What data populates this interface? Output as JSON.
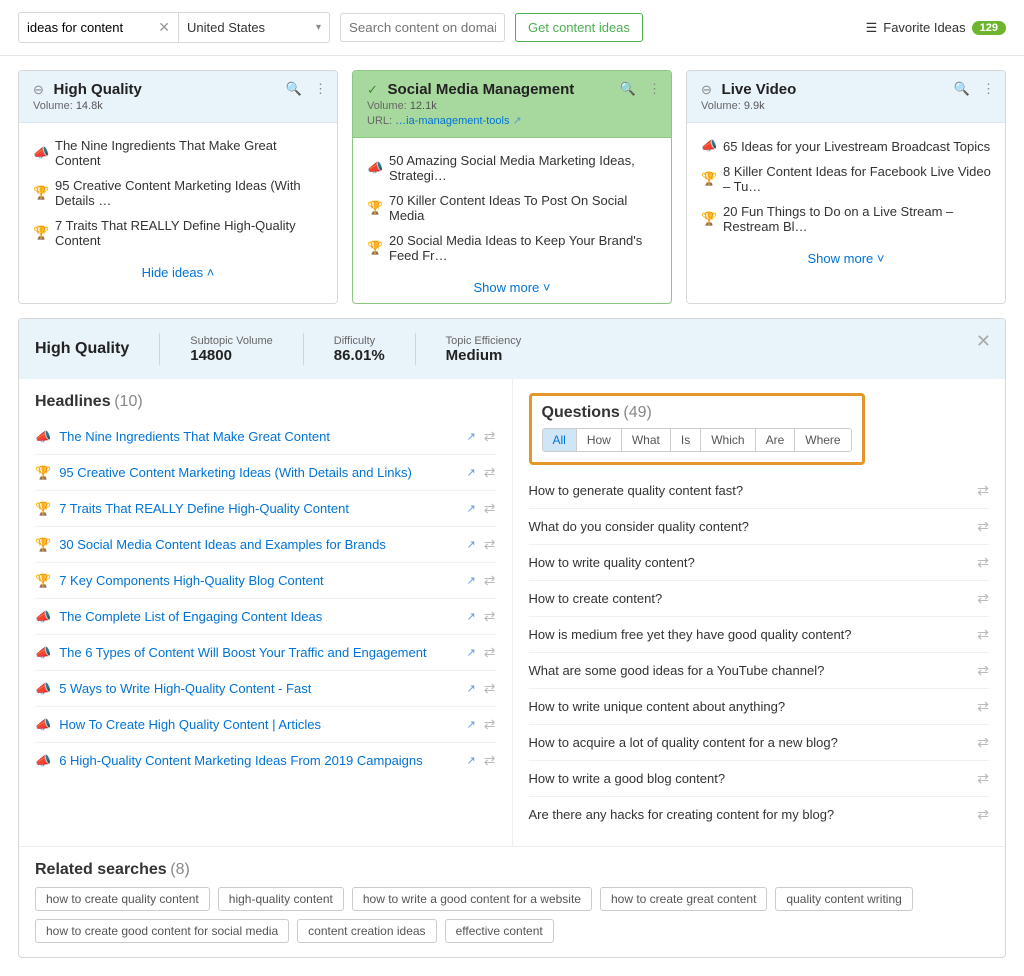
{
  "topbar": {
    "search_value": "ideas for content",
    "country": "United States",
    "domain_placeholder": "Search content on domain",
    "get_ideas_label": "Get content ideas",
    "favorite_label": "Favorite Ideas",
    "favorite_count": "129"
  },
  "cards": [
    {
      "title": "High Quality",
      "volume_label": "Volume:",
      "volume": "14.8k",
      "items": [
        "The Nine Ingredients That Make Great Content",
        "95 Creative Content Marketing Ideas (With Details …",
        "7 Traits That REALLY Define High-Quality Content"
      ],
      "more": "Hide ideas"
    },
    {
      "title": "Social Media Management",
      "volume_label": "Volume:",
      "volume": "12.1k",
      "url_label": "URL:",
      "url": "…ia-management-tools",
      "items": [
        "50 Amazing Social Media Marketing Ideas, Strategi…",
        "70 Killer Content Ideas To Post On Social Media",
        "20 Social Media Ideas to Keep Your Brand's Feed Fr…"
      ],
      "more": "Show more"
    },
    {
      "title": "Live Video",
      "volume_label": "Volume:",
      "volume": "9.9k",
      "items": [
        "65 Ideas for your Livestream Broadcast Topics",
        "8 Killer Content Ideas for Facebook Live Video – Tu…",
        "20 Fun Things to Do on a Live Stream – Restream Bl…"
      ],
      "more": "Show more"
    }
  ],
  "detail": {
    "title": "High Quality",
    "subtopic_label": "Subtopic Volume",
    "subtopic_value": "14800",
    "difficulty_label": "Difficulty",
    "difficulty_value": "86.01%",
    "efficiency_label": "Topic Efficiency",
    "efficiency_value": "Medium"
  },
  "headlines": {
    "title": "Headlines",
    "count": "(10)",
    "items": [
      "The Nine Ingredients That Make Great Content",
      "95 Creative Content Marketing Ideas (With Details and Links)",
      "7 Traits That REALLY Define High-Quality Content",
      "30 Social Media Content Ideas and Examples for Brands",
      "7 Key Components High-Quality Blog Content",
      "The Complete List of Engaging Content Ideas",
      "The 6 Types of Content Will Boost Your Traffic and Engagement",
      "5 Ways to Write High-Quality Content - Fast",
      "How To Create High Quality Content | Articles",
      "6 High-Quality Content Marketing Ideas From 2019 Campaigns"
    ],
    "icons": [
      "mega",
      "cup",
      "cup",
      "cup",
      "cup",
      "mega",
      "mega",
      "mega",
      "mega",
      "mega"
    ]
  },
  "questions": {
    "title": "Questions",
    "count": "(49)",
    "tabs": [
      "All",
      "How",
      "What",
      "Is",
      "Which",
      "Are",
      "Where"
    ],
    "active": "All",
    "items": [
      "How to generate quality content fast?",
      "What do you consider quality content?",
      "How to write quality content?",
      "How to create content?",
      "How is medium free yet they have good quality content?",
      "What are some good ideas for a YouTube channel?",
      "How to write unique content about anything?",
      "How to acquire a lot of quality content for a new blog?",
      "How to write a good blog content?",
      "Are there any hacks for creating content for my blog?"
    ]
  },
  "related": {
    "title": "Related searches",
    "count": "(8)",
    "items": [
      "how to create quality content",
      "high-quality content",
      "how to write a good content for a website",
      "how to create great content",
      "quality content writing",
      "how to create good content for social media",
      "content creation ideas",
      "effective content"
    ]
  }
}
